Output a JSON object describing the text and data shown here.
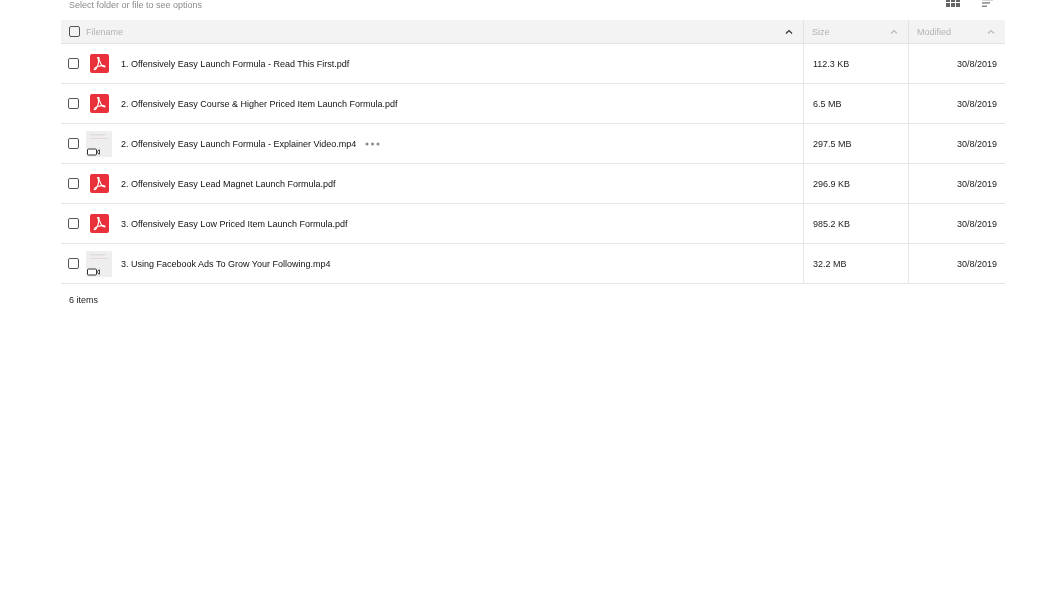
{
  "toolbar": {
    "hint": "Select folder or file to see options"
  },
  "table": {
    "select_all": {
      "checked": false
    },
    "columns": [
      {
        "label": "Filename",
        "sorted": true
      },
      {
        "label": "Size",
        "sorted": false
      },
      {
        "label": "Modified",
        "sorted": false
      }
    ],
    "rows": [
      {
        "kind": "pdf",
        "name": "1. Offensively Easy Launch Formula - Read This First.pdf",
        "size": "112.3 KB",
        "modified": "30/8/2019",
        "checked": false,
        "more": false
      },
      {
        "kind": "pdf",
        "name": "2. Offensively Easy Course & Higher Priced Item Launch Formula.pdf",
        "size": "6.5 MB",
        "modified": "30/8/2019",
        "checked": false,
        "more": false
      },
      {
        "kind": "video",
        "name": "2. Offensively Easy Launch Formula - Explainer Video.mp4",
        "size": "297.5 MB",
        "modified": "30/8/2019",
        "checked": false,
        "more": true
      },
      {
        "kind": "pdf",
        "name": "2. Offensively Easy Lead Magnet Launch Formula.pdf",
        "size": "296.9 KB",
        "modified": "30/8/2019",
        "checked": false,
        "more": false
      },
      {
        "kind": "pdf",
        "name": "3. Offensively Easy Low Priced Item Launch Formula.pdf",
        "size": "985.2 KB",
        "modified": "30/8/2019",
        "checked": false,
        "more": false
      },
      {
        "kind": "video",
        "name": "3. Using Facebook Ads To Grow Your Following.mp4",
        "size": "32.2 MB",
        "modified": "30/8/2019",
        "checked": false,
        "more": false
      }
    ]
  },
  "footer": {
    "count": "6 items"
  }
}
